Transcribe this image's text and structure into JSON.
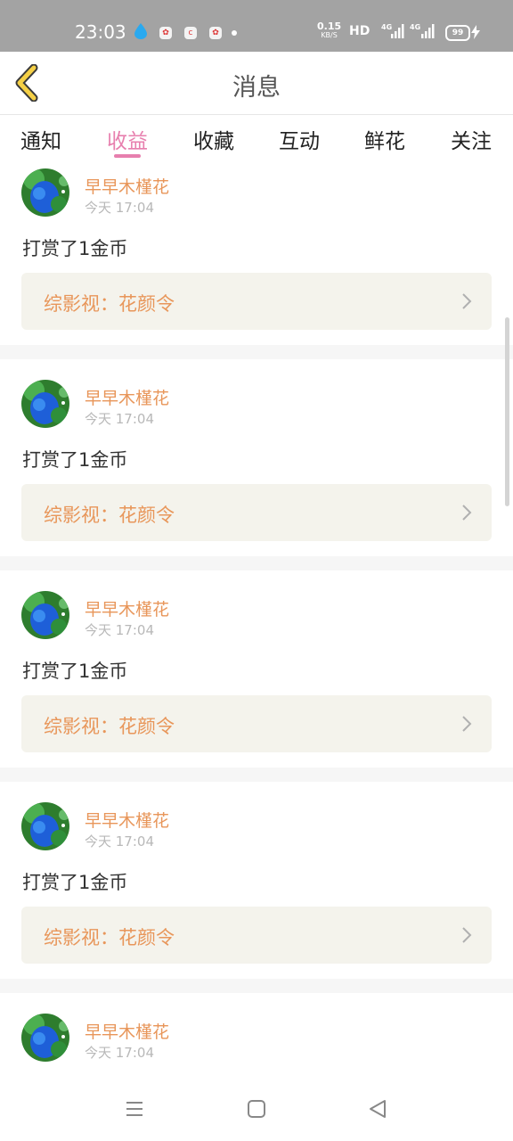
{
  "status_bar": {
    "time": "23:03",
    "net_speed": "0.15",
    "net_speed_unit": "KB/S",
    "hd_label": "HD",
    "signal_1_label": "4G",
    "signal_2_label": "4G",
    "battery": "99",
    "icons": [
      "droplet-icon",
      "app-icon",
      "app-icon",
      "app-icon",
      "dot-icon",
      "signal-icon",
      "signal-icon",
      "bolt-icon"
    ]
  },
  "header": {
    "title": "消息",
    "back_icon": "chevron-left-icon"
  },
  "tabs": [
    {
      "label": "通知",
      "active": false
    },
    {
      "label": "收益",
      "active": true
    },
    {
      "label": "收藏",
      "active": false
    },
    {
      "label": "互动",
      "active": false
    },
    {
      "label": "鲜花",
      "active": false
    },
    {
      "label": "关注",
      "active": false
    }
  ],
  "messages": [
    {
      "username": "早早木槿花",
      "time": "今天 17:04",
      "text": "打赏了1金币",
      "ref": "综影视：花颜令"
    },
    {
      "username": "早早木槿花",
      "time": "今天 17:04",
      "text": "打赏了1金币",
      "ref": "综影视：花颜令"
    },
    {
      "username": "早早木槿花",
      "time": "今天 17:04",
      "text": "打赏了1金币",
      "ref": "综影视：花颜令"
    },
    {
      "username": "早早木槿花",
      "time": "今天 17:04",
      "text": "打赏了1金币",
      "ref": "综影视：花颜令"
    },
    {
      "username": "早早木槿花",
      "time": "今天 17:04",
      "text": "",
      "ref": ""
    }
  ],
  "colors": {
    "accent_pink": "#e77fae",
    "username_orange": "#e8965a",
    "status_bar_bg": "#a3a3a3",
    "ref_box_bg": "#f4f3ec",
    "back_icon_fill": "#f5d046"
  },
  "bottom_nav": {
    "icons": [
      "menu-icon",
      "home-square-icon",
      "back-triangle-icon"
    ]
  }
}
